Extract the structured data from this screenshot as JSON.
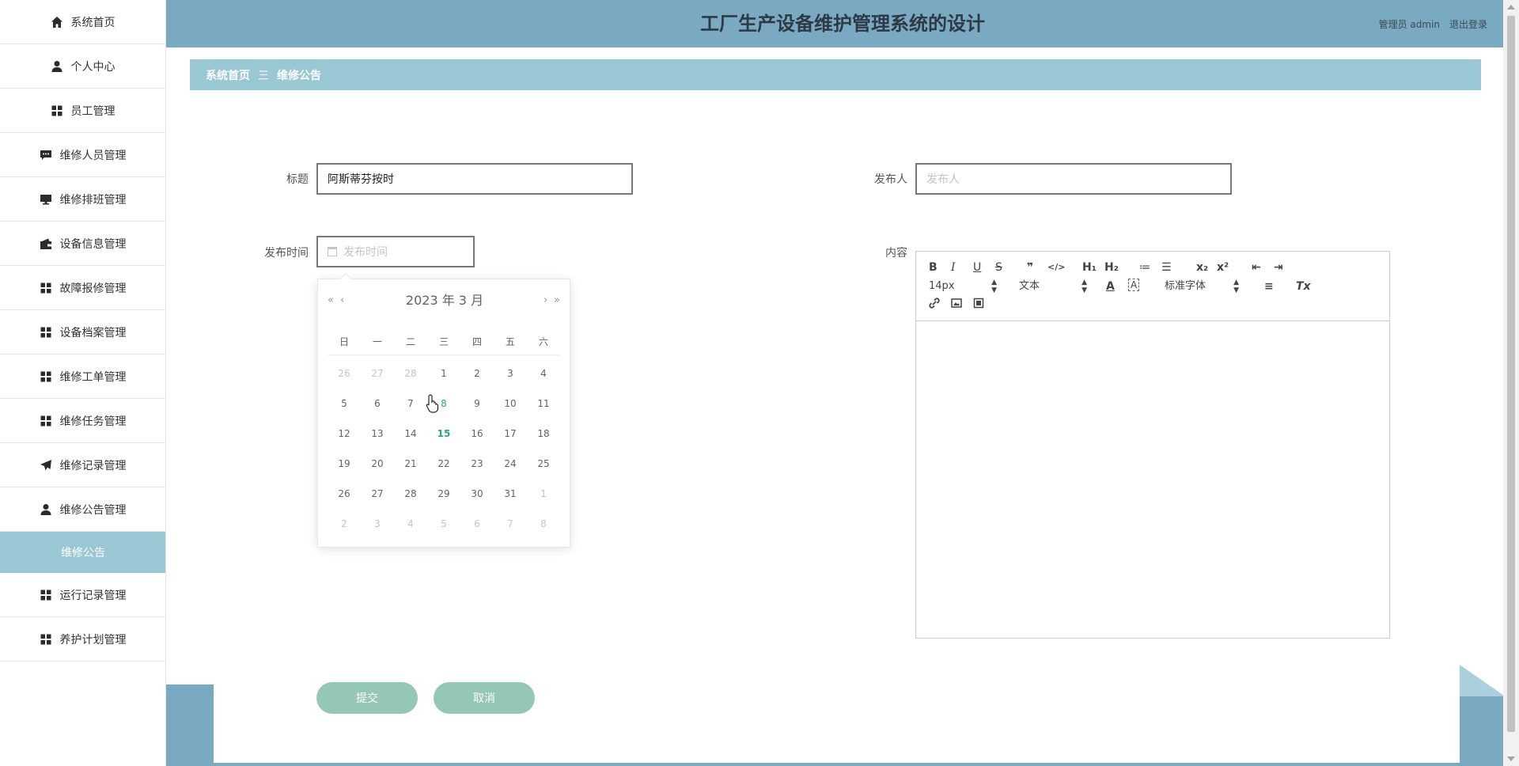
{
  "app": {
    "title": "工厂生产设备维护管理系统的设计",
    "user_text": "管理员 admin",
    "logout_label": "退出登录"
  },
  "sidebar": {
    "items": [
      {
        "label": "系统首页",
        "icon": "home-icon"
      },
      {
        "label": "个人中心",
        "icon": "user-icon"
      },
      {
        "label": "员工管理",
        "icon": "grid-icon"
      },
      {
        "label": "维修人员管理",
        "icon": "chat-icon"
      },
      {
        "label": "维修排班管理",
        "icon": "monitor-icon"
      },
      {
        "label": "设备信息管理",
        "icon": "wallet-icon"
      },
      {
        "label": "故障报修管理",
        "icon": "grid-icon"
      },
      {
        "label": "设备档案管理",
        "icon": "grid-icon"
      },
      {
        "label": "维修工单管理",
        "icon": "grid-icon"
      },
      {
        "label": "维修任务管理",
        "icon": "grid-icon"
      },
      {
        "label": "维修记录管理",
        "icon": "send-icon"
      },
      {
        "label": "维修公告管理",
        "icon": "user-icon"
      }
    ],
    "subitem": "维修公告",
    "items_after": [
      {
        "label": "运行记录管理",
        "icon": "grid-icon"
      },
      {
        "label": "养护计划管理",
        "icon": "grid-icon"
      }
    ]
  },
  "breadcrumb": {
    "home": "系统首页",
    "separator": "三",
    "current": "维修公告"
  },
  "form": {
    "title_label": "标题",
    "title_value": "阿斯蒂芬按时",
    "publisher_label": "发布人",
    "publisher_placeholder": "发布人",
    "time_label": "发布时间",
    "time_placeholder": "发布时间",
    "content_label": "内容",
    "submit_label": "提交",
    "cancel_label": "取消"
  },
  "datepicker": {
    "title": "2023 年  3 月",
    "prev_year": "«",
    "prev_month": "‹",
    "next_month": "›",
    "next_year": "»",
    "weekdays": [
      "日",
      "一",
      "二",
      "三",
      "四",
      "五",
      "六"
    ],
    "days": [
      [
        "26",
        "27",
        "28",
        "1",
        "2",
        "3",
        "4"
      ],
      [
        "5",
        "6",
        "7",
        "8",
        "9",
        "10",
        "11"
      ],
      [
        "12",
        "13",
        "14",
        "15",
        "16",
        "17",
        "18"
      ],
      [
        "19",
        "20",
        "21",
        "22",
        "23",
        "24",
        "25"
      ],
      [
        "26",
        "27",
        "28",
        "29",
        "30",
        "31",
        "1"
      ],
      [
        "2",
        "3",
        "4",
        "5",
        "6",
        "7",
        "8"
      ]
    ],
    "today": "15",
    "hovered": "8"
  },
  "editor": {
    "font_size": "14px",
    "header_select": "文本",
    "font_family": "标准字体",
    "buttons": {
      "bold": "B",
      "italic": "I",
      "underline": "U",
      "strike": "S",
      "quote": "❞",
      "code": "</>",
      "h1": "H₁",
      "h2": "H₂",
      "ordered_list": "≔",
      "bullet_list": "☰",
      "subscript": "x₂",
      "superscript": "x²",
      "outdent": "⇤",
      "indent": "⇥",
      "color": "A",
      "background": "A",
      "align": "≡",
      "clean": "Tx"
    }
  }
}
